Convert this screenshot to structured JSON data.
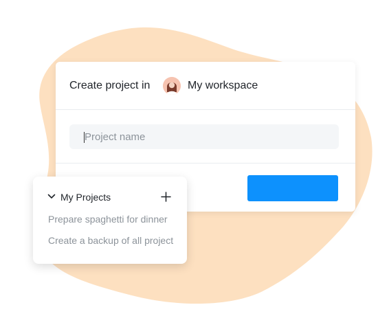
{
  "dialog": {
    "title": "Create project in",
    "workspace": "My workspace",
    "input_placeholder": "Project name",
    "input_value": "",
    "primary_button_label": ""
  },
  "projects": {
    "title": "My Projects",
    "items": [
      {
        "label": "Prepare spaghetti for dinner"
      },
      {
        "label": "Create a backup of all project"
      }
    ]
  },
  "icons": {
    "avatar": "user-avatar",
    "toggle": "chevron-down-icon",
    "add": "plus-icon"
  },
  "colors": {
    "blob": "#fde0c0",
    "primary": "#0d91fd",
    "text": "#1f2329",
    "muted": "#8c939a",
    "input_bg": "#f4f6f8"
  }
}
